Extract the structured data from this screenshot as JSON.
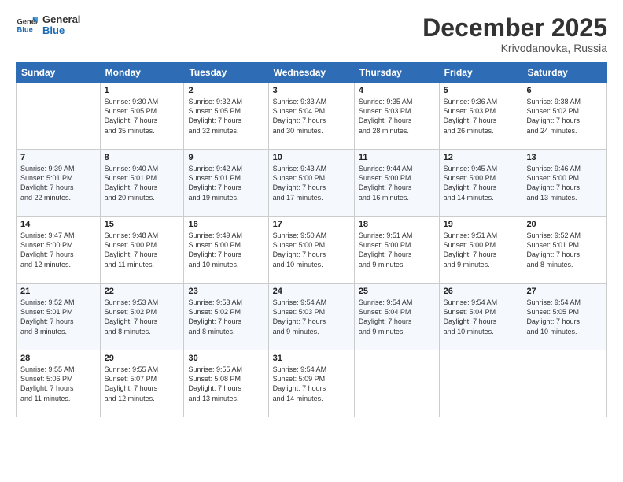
{
  "logo": {
    "line1": "General",
    "line2": "Blue"
  },
  "title": "December 2025",
  "subtitle": "Krivodanovka, Russia",
  "header": {
    "days": [
      "Sunday",
      "Monday",
      "Tuesday",
      "Wednesday",
      "Thursday",
      "Friday",
      "Saturday"
    ]
  },
  "weeks": [
    [
      {
        "num": "",
        "info": ""
      },
      {
        "num": "1",
        "info": "Sunrise: 9:30 AM\nSunset: 5:05 PM\nDaylight: 7 hours\nand 35 minutes."
      },
      {
        "num": "2",
        "info": "Sunrise: 9:32 AM\nSunset: 5:05 PM\nDaylight: 7 hours\nand 32 minutes."
      },
      {
        "num": "3",
        "info": "Sunrise: 9:33 AM\nSunset: 5:04 PM\nDaylight: 7 hours\nand 30 minutes."
      },
      {
        "num": "4",
        "info": "Sunrise: 9:35 AM\nSunset: 5:03 PM\nDaylight: 7 hours\nand 28 minutes."
      },
      {
        "num": "5",
        "info": "Sunrise: 9:36 AM\nSunset: 5:03 PM\nDaylight: 7 hours\nand 26 minutes."
      },
      {
        "num": "6",
        "info": "Sunrise: 9:38 AM\nSunset: 5:02 PM\nDaylight: 7 hours\nand 24 minutes."
      }
    ],
    [
      {
        "num": "7",
        "info": "Sunrise: 9:39 AM\nSunset: 5:01 PM\nDaylight: 7 hours\nand 22 minutes."
      },
      {
        "num": "8",
        "info": "Sunrise: 9:40 AM\nSunset: 5:01 PM\nDaylight: 7 hours\nand 20 minutes."
      },
      {
        "num": "9",
        "info": "Sunrise: 9:42 AM\nSunset: 5:01 PM\nDaylight: 7 hours\nand 19 minutes."
      },
      {
        "num": "10",
        "info": "Sunrise: 9:43 AM\nSunset: 5:00 PM\nDaylight: 7 hours\nand 17 minutes."
      },
      {
        "num": "11",
        "info": "Sunrise: 9:44 AM\nSunset: 5:00 PM\nDaylight: 7 hours\nand 16 minutes."
      },
      {
        "num": "12",
        "info": "Sunrise: 9:45 AM\nSunset: 5:00 PM\nDaylight: 7 hours\nand 14 minutes."
      },
      {
        "num": "13",
        "info": "Sunrise: 9:46 AM\nSunset: 5:00 PM\nDaylight: 7 hours\nand 13 minutes."
      }
    ],
    [
      {
        "num": "14",
        "info": "Sunrise: 9:47 AM\nSunset: 5:00 PM\nDaylight: 7 hours\nand 12 minutes."
      },
      {
        "num": "15",
        "info": "Sunrise: 9:48 AM\nSunset: 5:00 PM\nDaylight: 7 hours\nand 11 minutes."
      },
      {
        "num": "16",
        "info": "Sunrise: 9:49 AM\nSunset: 5:00 PM\nDaylight: 7 hours\nand 10 minutes."
      },
      {
        "num": "17",
        "info": "Sunrise: 9:50 AM\nSunset: 5:00 PM\nDaylight: 7 hours\nand 10 minutes."
      },
      {
        "num": "18",
        "info": "Sunrise: 9:51 AM\nSunset: 5:00 PM\nDaylight: 7 hours\nand 9 minutes."
      },
      {
        "num": "19",
        "info": "Sunrise: 9:51 AM\nSunset: 5:00 PM\nDaylight: 7 hours\nand 9 minutes."
      },
      {
        "num": "20",
        "info": "Sunrise: 9:52 AM\nSunset: 5:01 PM\nDaylight: 7 hours\nand 8 minutes."
      }
    ],
    [
      {
        "num": "21",
        "info": "Sunrise: 9:52 AM\nSunset: 5:01 PM\nDaylight: 7 hours\nand 8 minutes."
      },
      {
        "num": "22",
        "info": "Sunrise: 9:53 AM\nSunset: 5:02 PM\nDaylight: 7 hours\nand 8 minutes."
      },
      {
        "num": "23",
        "info": "Sunrise: 9:53 AM\nSunset: 5:02 PM\nDaylight: 7 hours\nand 8 minutes."
      },
      {
        "num": "24",
        "info": "Sunrise: 9:54 AM\nSunset: 5:03 PM\nDaylight: 7 hours\nand 9 minutes."
      },
      {
        "num": "25",
        "info": "Sunrise: 9:54 AM\nSunset: 5:04 PM\nDaylight: 7 hours\nand 9 minutes."
      },
      {
        "num": "26",
        "info": "Sunrise: 9:54 AM\nSunset: 5:04 PM\nDaylight: 7 hours\nand 10 minutes."
      },
      {
        "num": "27",
        "info": "Sunrise: 9:54 AM\nSunset: 5:05 PM\nDaylight: 7 hours\nand 10 minutes."
      }
    ],
    [
      {
        "num": "28",
        "info": "Sunrise: 9:55 AM\nSunset: 5:06 PM\nDaylight: 7 hours\nand 11 minutes."
      },
      {
        "num": "29",
        "info": "Sunrise: 9:55 AM\nSunset: 5:07 PM\nDaylight: 7 hours\nand 12 minutes."
      },
      {
        "num": "30",
        "info": "Sunrise: 9:55 AM\nSunset: 5:08 PM\nDaylight: 7 hours\nand 13 minutes."
      },
      {
        "num": "31",
        "info": "Sunrise: 9:54 AM\nSunset: 5:09 PM\nDaylight: 7 hours\nand 14 minutes."
      },
      {
        "num": "",
        "info": ""
      },
      {
        "num": "",
        "info": ""
      },
      {
        "num": "",
        "info": ""
      }
    ]
  ]
}
